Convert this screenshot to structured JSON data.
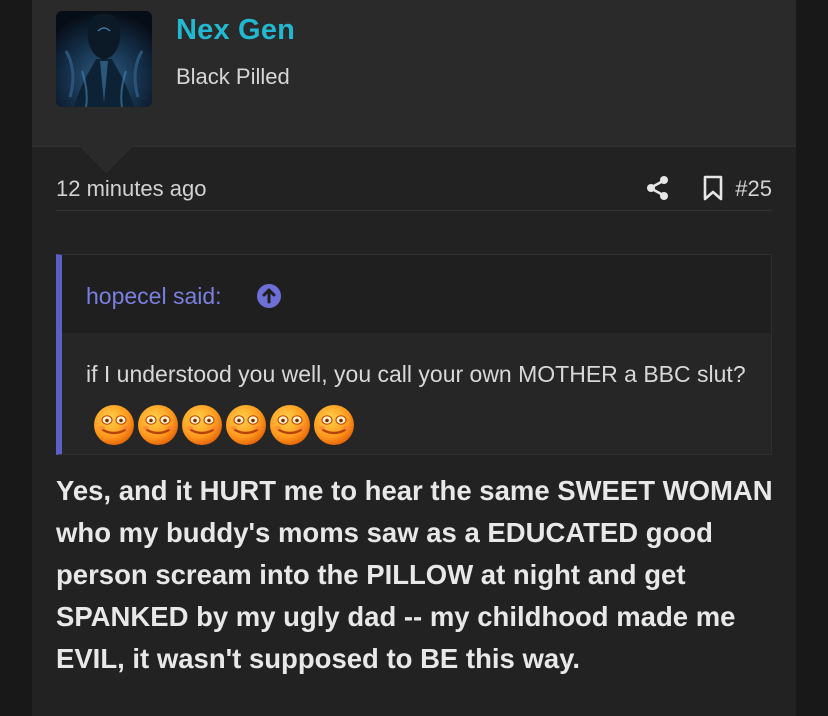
{
  "user": {
    "name": "Nex Gen",
    "title": "Black Pilled"
  },
  "post": {
    "time": "12 minutes ago",
    "number": "#25",
    "quote": {
      "author": "hopecel said:",
      "text": "if I understood you well, you call your own MOTHER a BBC slut?",
      "emoji_count": 6,
      "emoji_icon": "laughing-face-icon"
    },
    "message": "Yes, and it HURT me to hear the same SWEET WOMAN who my buddy's moms saw as a EDUCATED good person scream into the PILLOW at night and get SPANKED by my ugly dad -- my childhood made me EVIL, it wasn't supposed to BE this way."
  },
  "colors": {
    "username": "#22b8cf",
    "quote_accent": "#5c5fc4",
    "quote_author": "#7b7fe0"
  }
}
